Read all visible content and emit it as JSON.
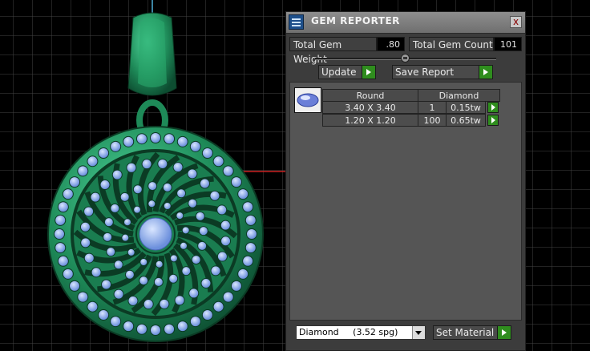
{
  "window": {
    "title": "GEM REPORTER",
    "close_label": "x"
  },
  "summary": {
    "weight_label": "Total Gem Weight",
    "weight_value": ".80",
    "count_label": "Total Gem Count",
    "count_value": "101"
  },
  "actions": {
    "update_label": "Update",
    "save_label": "Save Report"
  },
  "table": {
    "shape_header": "Round",
    "material_header": "Diamond",
    "rows": [
      {
        "size": "3.40 X 3.40",
        "count": "1",
        "weight": "0.15tw"
      },
      {
        "size": "1.20 X 1.20",
        "count": "100",
        "weight": "0.65tw"
      }
    ]
  },
  "material": {
    "selected": "Diamond     (3.52 spg)",
    "set_label": "Set Material"
  },
  "icons": [
    "gem-reporter-icon",
    "close-icon",
    "slider-knob-icon",
    "play-arrow-icon",
    "round-diamond-icon",
    "dropdown-arrow-icon"
  ],
  "colors": {
    "pendant": "#1f8a5a",
    "gem": "#8cb0e8",
    "grid": "#4a4a4a",
    "accent_button": "#2f8d1e",
    "panel": "#3c3c3c"
  }
}
